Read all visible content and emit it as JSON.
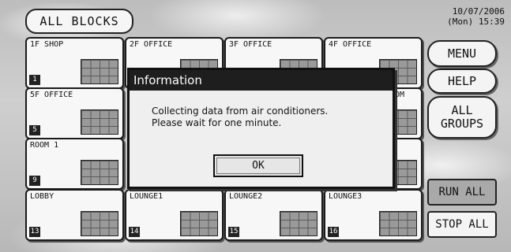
{
  "header": {
    "title": "ALL BLOCKS"
  },
  "clock": {
    "date": "10/07/2006",
    "time": "(Mon) 15:39"
  },
  "blocks": [
    {
      "name": "1F SHOP",
      "number": "1"
    },
    {
      "name": "2F OFFICE",
      "number": ""
    },
    {
      "name": "3F OFFICE",
      "number": ""
    },
    {
      "name": "4F OFFICE",
      "number": ""
    },
    {
      "name": "5F OFFICE",
      "number": "5"
    },
    {
      "name": "",
      "number": ""
    },
    {
      "name": "",
      "number": ""
    },
    {
      "name": "OOM",
      "number": ""
    },
    {
      "name": "ROOM 1",
      "number": "9"
    },
    {
      "name": "",
      "number": ""
    },
    {
      "name": "",
      "number": ""
    },
    {
      "name": "",
      "number": ""
    },
    {
      "name": "LOBBY",
      "number": "13"
    },
    {
      "name": "LOUNGE1",
      "number": "14"
    },
    {
      "name": "LOUNGE2",
      "number": "15"
    },
    {
      "name": "LOUNGE3",
      "number": "16"
    }
  ],
  "sidebar": {
    "menu": "MENU",
    "help": "HELP",
    "all_groups_line1": "ALL",
    "all_groups_line2": "GROUPS",
    "run_all": "RUN ALL",
    "stop_all": "STOP ALL",
    "run_all_color": "#a9a9a9"
  },
  "dialog": {
    "title": "Information",
    "line1": "Collecting data from air conditioners.",
    "line2": "Please wait for one minute.",
    "ok": "OK"
  }
}
